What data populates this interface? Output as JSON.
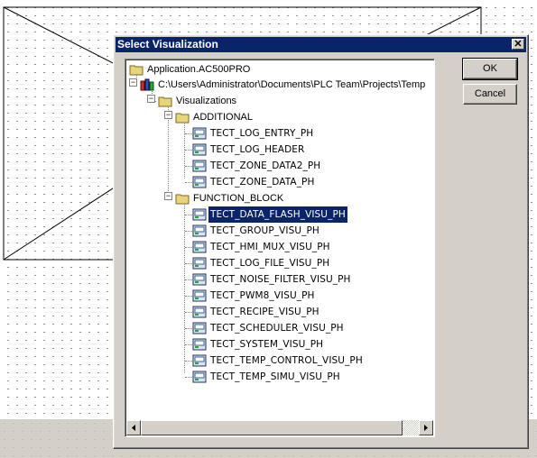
{
  "dialog": {
    "title": "Select Visualization",
    "close_symbol": "✕",
    "ok_label": "OK",
    "cancel_label": "Cancel"
  },
  "tree": {
    "root": "Application.AC500PRO",
    "project_path": "C:\\Users\\Administrator\\Documents\\PLC Team\\Projects\\Temp",
    "visualizations_folder": "Visualizations",
    "additional_folder": "ADDITIONAL",
    "additional_items": [
      "TECT_LOG_ENTRY_PH",
      "TECT_LOG_HEADER",
      "TECT_ZONE_DATA2_PH",
      "TECT_ZONE_DATA_PH"
    ],
    "function_block_folder": "FUNCTION_BLOCK",
    "function_block_items": [
      "TECT_DATA_FLASH_VISU_PH",
      "TECT_GROUP_VISU_PH",
      "TECT_HMI_MUX_VISU_PH",
      "TECT_LOG_FILE_VISU_PH",
      "TECT_NOISE_FILTER_VISU_PH",
      "TECT_PWM8_VISU_PH",
      "TECT_RECIPE_VISU_PH",
      "TECT_SCHEDULER_VISU_PH",
      "TECT_SYSTEM_VISU_PH",
      "TECT_TEMP_CONTROL_VISU_PH",
      "TECT_TEMP_SIMU_VISU_PH"
    ],
    "selected_item": "TECT_DATA_FLASH_VISU_PH",
    "expanded_symbol": "−"
  },
  "icons": {
    "folder": "folder-icon",
    "project": "project-icon",
    "visualization": "visualization-icon"
  },
  "colors": {
    "selection": "#0a246a",
    "titlebar": "#0a246a",
    "dialog_face": "#d4d0c8"
  }
}
